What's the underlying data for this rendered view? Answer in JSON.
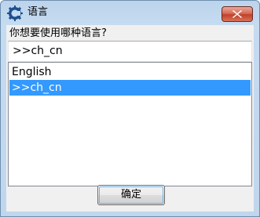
{
  "window": {
    "title": "语言",
    "app_icon": "gear-logo-icon",
    "close_icon": "close-icon",
    "accent_close": "#c7432c"
  },
  "dialog": {
    "prompt": "你想要使用哪种语言?",
    "input_value": ">>ch_cn",
    "list_items": [
      {
        "label": "English",
        "selected": false
      },
      {
        "label": ">>ch_cn",
        "selected": true
      }
    ],
    "ok_label": "确定",
    "selection_color": "#3399ff"
  }
}
